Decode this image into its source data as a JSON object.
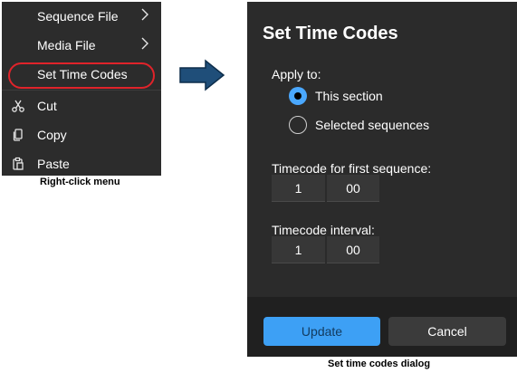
{
  "context_menu": {
    "items": [
      {
        "label": "Sequence File",
        "icon": "",
        "submenu": true
      },
      {
        "label": "Media File",
        "icon": "",
        "submenu": true
      },
      {
        "label": "Set Time Codes",
        "icon": "",
        "submenu": false,
        "highlighted": true
      },
      {
        "label": "Cut",
        "icon": "scissors-icon",
        "submenu": false
      },
      {
        "label": "Copy",
        "icon": "copy-icon",
        "submenu": false
      },
      {
        "label": "Paste",
        "icon": "paste-icon",
        "submenu": false
      }
    ],
    "caption": "Right-click menu",
    "highlight_color": "#e0232a"
  },
  "dialog": {
    "title": "Set Time Codes",
    "apply_to_label": "Apply to:",
    "options": [
      {
        "label": "This section",
        "checked": true
      },
      {
        "label": "Selected sequences",
        "checked": false
      }
    ],
    "first_sequence_label": "Timecode for first sequence:",
    "first_sequence_values": [
      "1",
      "00"
    ],
    "interval_label": "Timecode interval:",
    "interval_values": [
      "1",
      "00"
    ],
    "update_button": "Update",
    "cancel_button": "Cancel",
    "caption": "Set time codes dialog",
    "accent_color": "#3da0f5"
  }
}
